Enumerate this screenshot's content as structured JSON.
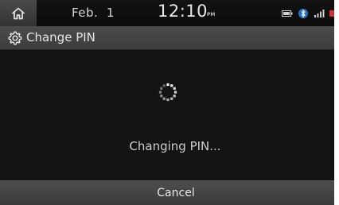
{
  "status_bar": {
    "home_icon": "home-icon",
    "date": "Feb.  1",
    "time": "12:10",
    "ampm": "PM",
    "indicators": [
      "battery-icon",
      "bluetooth-icon",
      "signal-icon",
      "mute-icon"
    ]
  },
  "title_bar": {
    "icon": "gear-icon",
    "title": "Change PIN"
  },
  "main": {
    "spinner_icon": "loading-spinner-icon",
    "message": "Changing PIN..."
  },
  "footer": {
    "cancel_label": "Cancel"
  },
  "colors": {
    "background": "#141414",
    "bar": "#444444",
    "text": "#e6e6e6",
    "mute_indicator": "#d03030"
  }
}
